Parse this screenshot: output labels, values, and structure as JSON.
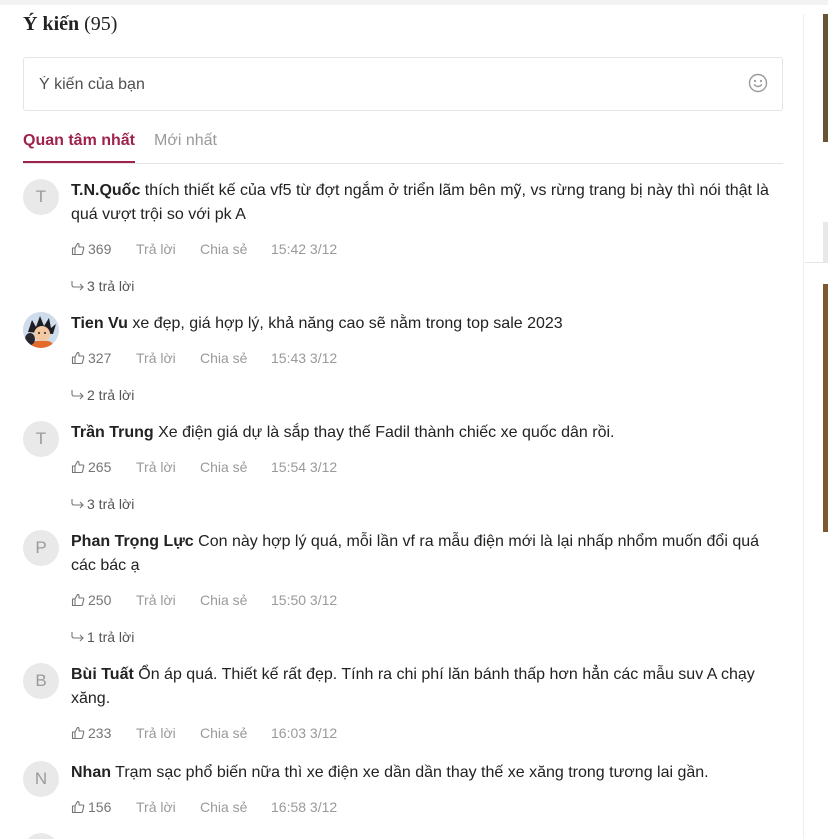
{
  "header": {
    "title": "Ý kiến",
    "count": "(95)"
  },
  "comment_input": {
    "placeholder": "Ý kiến của bạn",
    "emoji_icon": "smile-icon"
  },
  "tabs": [
    {
      "label": "Quan tâm nhất",
      "active": true
    },
    {
      "label": "Mới nhất",
      "active": false
    }
  ],
  "colors": {
    "accent": "#9f224e",
    "muted": "#9a9a9a",
    "border": "#e5e5e5"
  },
  "comments": [
    {
      "avatar": "T",
      "author": "T.N.Quốc",
      "text": "thích thiết kế của vf5 từ đợt ngắm ở triển lãm bên mỹ, vs rừng trang bị này thì nói thật là quá vượt trội so với pk A",
      "likes": "369",
      "reply_label": "Trả lời",
      "share_label": "Chia sẻ",
      "time": "15:42 3/12",
      "replies": "3 trả lời"
    },
    {
      "avatar": "",
      "author": "Tien Vu",
      "text": "xe đẹp, giá hợp lý, khả năng cao sẽ nằm trong top sale 2023",
      "likes": "327",
      "reply_label": "Trả lời",
      "share_label": "Chia sẻ",
      "time": "15:43 3/12",
      "replies": "2 trả lời"
    },
    {
      "avatar": "T",
      "author": "Trần Trung",
      "text": "Xe điện giá dự là sắp thay thế Fadil thành chiếc xe quốc dân rồi.",
      "likes": "265",
      "reply_label": "Trả lời",
      "share_label": "Chia sẻ",
      "time": "15:54 3/12",
      "replies": "3 trả lời"
    },
    {
      "avatar": "P",
      "author": "Phan Trọng Lực",
      "text": "Con này hợp lý quá, mỗi lần vf ra mẫu điện mới là lại nhấp nhổm muốn đổi quá các bác ạ",
      "likes": "250",
      "reply_label": "Trả lời",
      "share_label": "Chia sẻ",
      "time": "15:50 3/12",
      "replies": "1 trả lời"
    },
    {
      "avatar": "B",
      "author": "Bùi Tuất",
      "text": "Ổn áp quá. Thiết kế rất đẹp. Tính ra chi phí lăn bánh thấp hơn hẳn các mẫu suv A chạy xăng.",
      "likes": "233",
      "reply_label": "Trả lời",
      "share_label": "Chia sẻ",
      "time": "16:03 3/12",
      "replies": ""
    },
    {
      "avatar": "N",
      "author": "Nhan",
      "text": "Trạm sạc phổ biến nữa thì xe điện xe dần dần thay thế xe xăng trong tương lai gần.",
      "likes": "156",
      "reply_label": "Trả lời",
      "share_label": "Chia sẻ",
      "time": "16:58 3/12",
      "replies": ""
    }
  ]
}
